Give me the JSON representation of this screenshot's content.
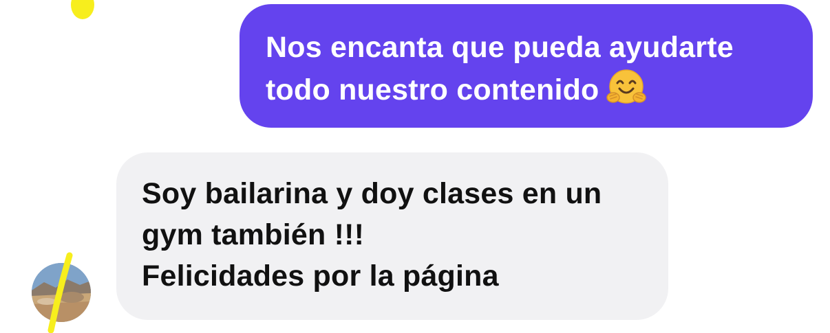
{
  "conversation": {
    "messages": [
      {
        "direction": "outgoing",
        "lines": [
          "Nos encanta que pueda ayudarte",
          "todo nuestro contenido"
        ],
        "emoji": "hugging-face-emoji"
      },
      {
        "direction": "incoming",
        "lines": [
          "Soy bailarina y doy clases en un",
          "gym también !!!",
          "Felicidades por la página"
        ]
      }
    ]
  },
  "colors": {
    "outgoing_bubble": "#6443ee",
    "incoming_bubble": "#f1f1f3",
    "highlighter": "#f7ee1d"
  }
}
